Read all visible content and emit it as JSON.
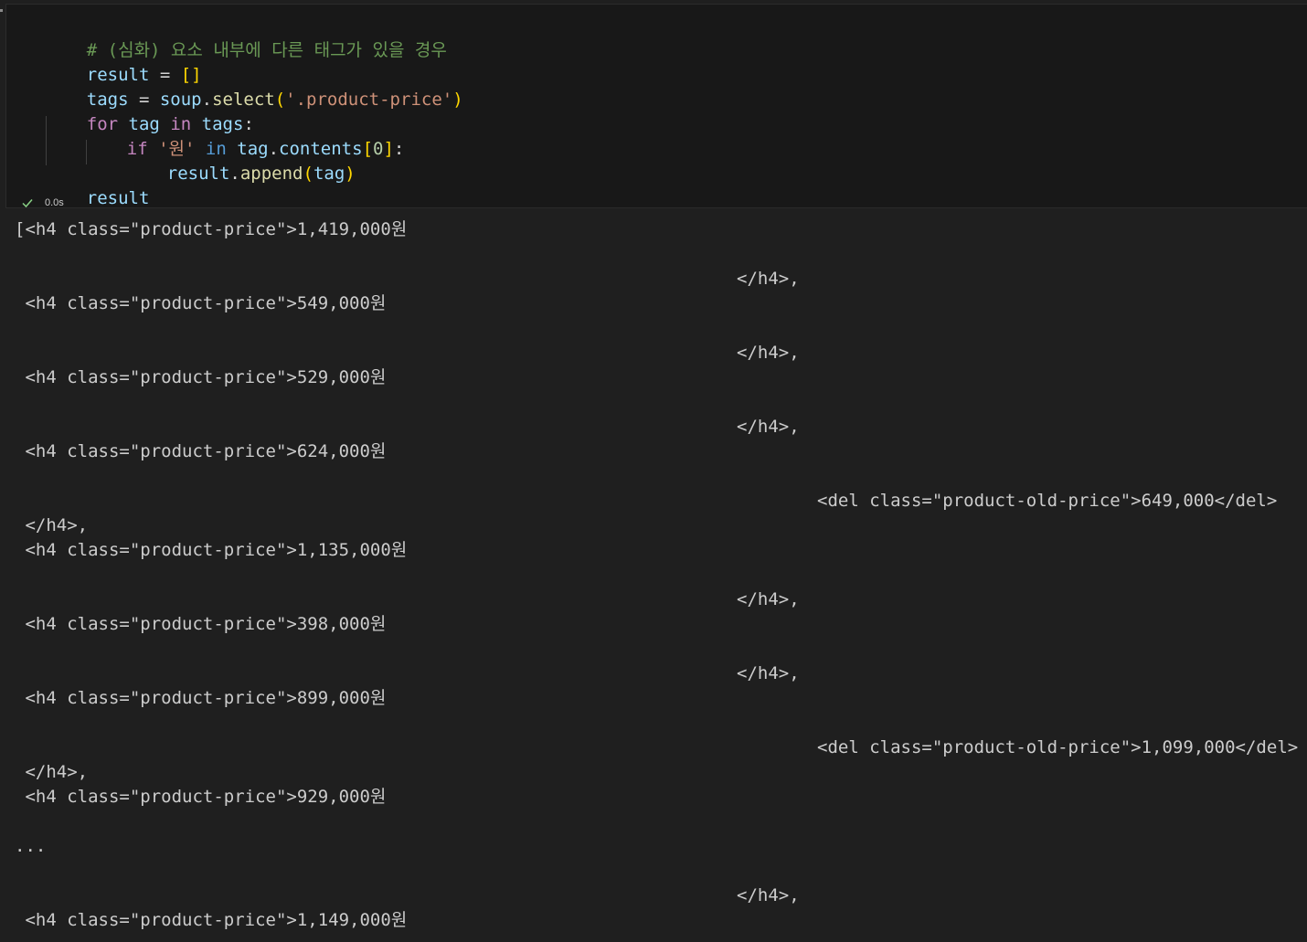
{
  "cell": {
    "code": {
      "comment": "# (심화) 요소 내부에 다른 태그가 있을 경우",
      "line1": {
        "var": "result",
        "op": " = ",
        "bracket": "[]"
      },
      "line2": {
        "var": "tags",
        "op": " = ",
        "obj": "soup",
        "dot": ".",
        "fn": "select",
        "open": "(",
        "str": "'.product-price'",
        "close": ")"
      },
      "line3": {
        "kw_for": "for",
        "var1": "tag",
        "kw_in": "in",
        "var2": "tags",
        "colon": ":"
      },
      "line4": {
        "kw_if": "if",
        "str": "'원'",
        "kw_in": "in",
        "obj": "tag",
        "dot": ".",
        "attr": "contents",
        "open": "[",
        "num": "0",
        "close": "]",
        "colon": ":"
      },
      "line5": {
        "obj": "result",
        "dot": ".",
        "fn": "append",
        "open": "(",
        "arg": "tag",
        "close": ")"
      },
      "line6": {
        "var": "result"
      }
    },
    "status": {
      "icon": "check-icon",
      "duration": "0.0s",
      "color": "#89d185"
    }
  },
  "output": {
    "lines": [
      "[<h4 class=\"product-price\">1,419,000원",
      "</h4>,",
      " <h4 class=\"product-price\">549,000원",
      "</h4>,",
      " <h4 class=\"product-price\">529,000원",
      "</h4>,",
      " <h4 class=\"product-price\">624,000원",
      "<del class=\"product-old-price\">649,000</del>",
      " </h4>,",
      " <h4 class=\"product-price\">1,135,000원",
      "</h4>,",
      " <h4 class=\"product-price\">398,000원",
      "</h4>,",
      " <h4 class=\"product-price\">899,000원",
      "<del class=\"product-old-price\">1,099,000</del>",
      " </h4>,",
      " <h4 class=\"product-price\">929,000원",
      "...",
      "</h4>,",
      " <h4 class=\"product-price\">1,149,000원"
    ]
  }
}
